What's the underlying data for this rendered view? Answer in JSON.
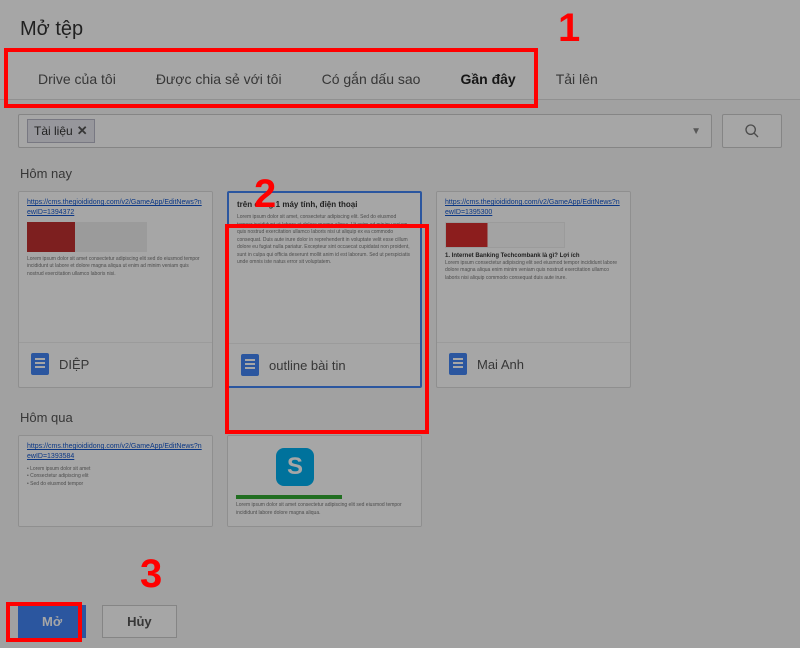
{
  "title": "Mở tệp",
  "tabs": [
    {
      "label": "Drive của tôi",
      "active": false
    },
    {
      "label": "Được chia sẻ với tôi",
      "active": false
    },
    {
      "label": "Có gắn dấu sao",
      "active": false
    },
    {
      "label": "Gần đây",
      "active": true
    },
    {
      "label": "Tải lên",
      "active": false
    }
  ],
  "filter": {
    "chip": "Tài liệu"
  },
  "sections": {
    "today": {
      "label": "Hôm nay"
    },
    "yesterday": {
      "label": "Hôm qua"
    }
  },
  "files_today": [
    {
      "name": "DIỆP",
      "link": "https://cms.thegioididong.com/v2/GameApp/EditNews?newID=1394372",
      "selected": false
    },
    {
      "name": "outline bài tin",
      "heading": "trên cùng 1 máy tính, điện thoại",
      "selected": true
    },
    {
      "name": "Mai Anh",
      "link": "https://cms.thegioididong.com/v2/GameApp/EditNews?newID=1395300",
      "sub": "1. Internet Banking Techcombank là gì? Lợi ích",
      "selected": false
    }
  ],
  "files_yesterday": [
    {
      "name": "",
      "link": "https://cms.thegioididong.com/v2/GameApp/EditNews?newID=1393584"
    },
    {
      "name": ""
    }
  ],
  "buttons": {
    "open": "Mở",
    "cancel": "Hủy"
  },
  "annotations": {
    "n1": "1",
    "n2": "2",
    "n3": "3"
  }
}
